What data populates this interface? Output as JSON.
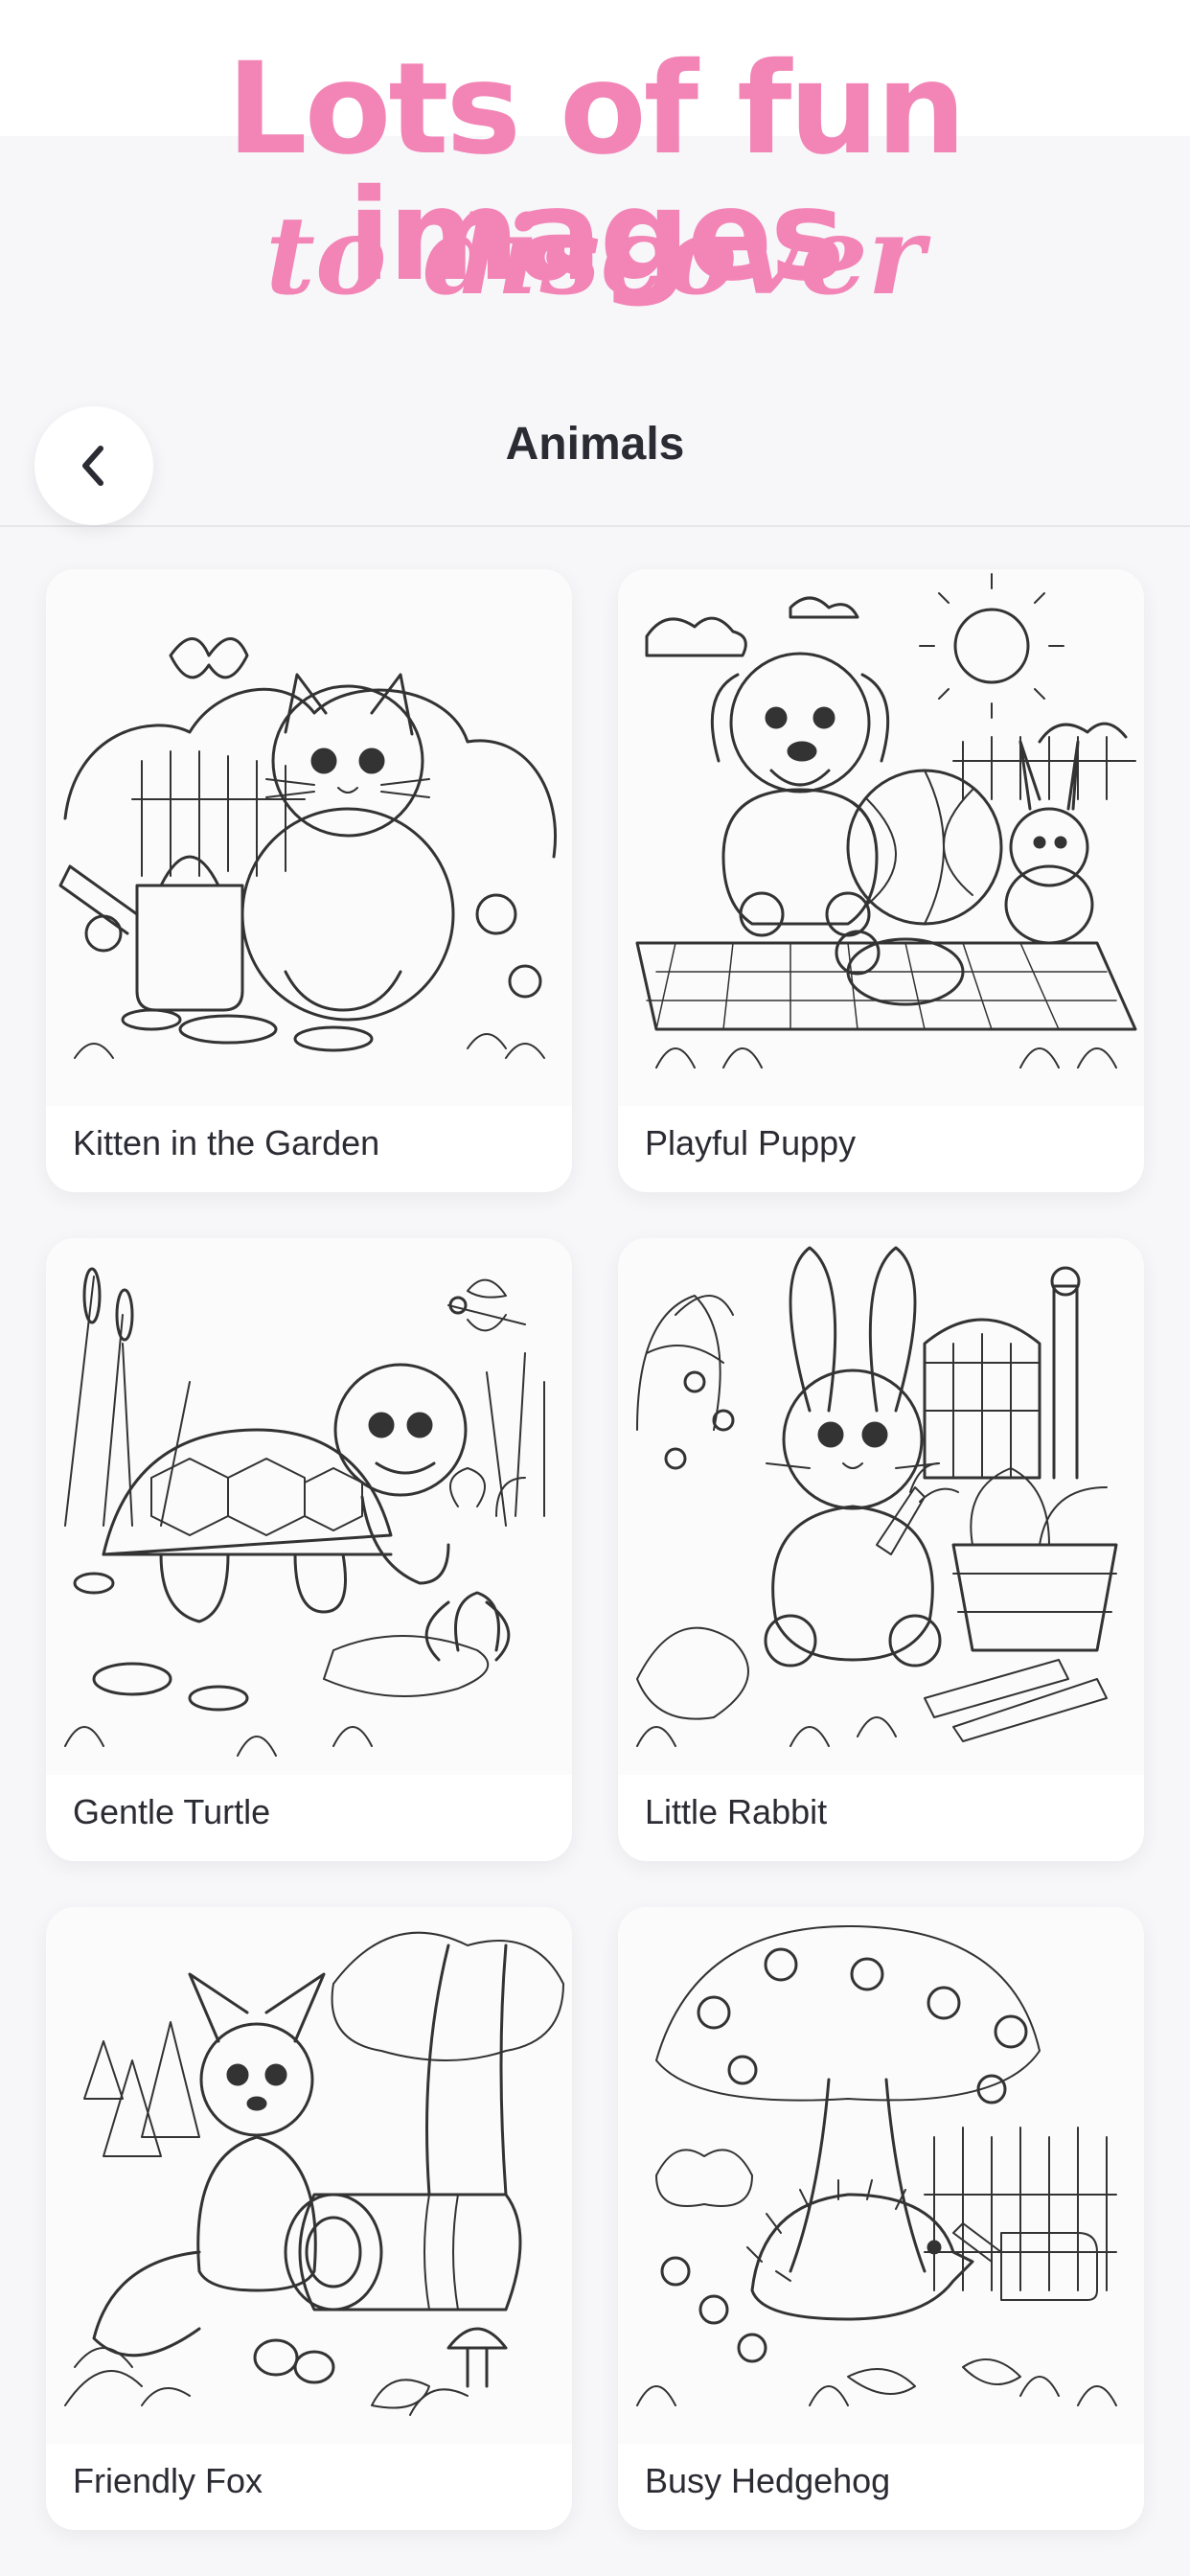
{
  "promo": {
    "title": "Lots of fun images",
    "subtitle": "to discover"
  },
  "nav": {
    "back_icon": "chevron-left-icon",
    "title": "Animals"
  },
  "items": [
    {
      "title": "Kitten in the Garden"
    },
    {
      "title": "Playful Puppy"
    },
    {
      "title": "Gentle Turtle"
    },
    {
      "title": "Little Rabbit"
    },
    {
      "title": "Friendly Fox"
    },
    {
      "title": "Busy Hedgehog"
    }
  ],
  "colors": {
    "accent": "#f285b6",
    "text": "#2b2b33",
    "background": "#f7f7fa",
    "card": "#ffffff",
    "line_art": "#333333"
  }
}
